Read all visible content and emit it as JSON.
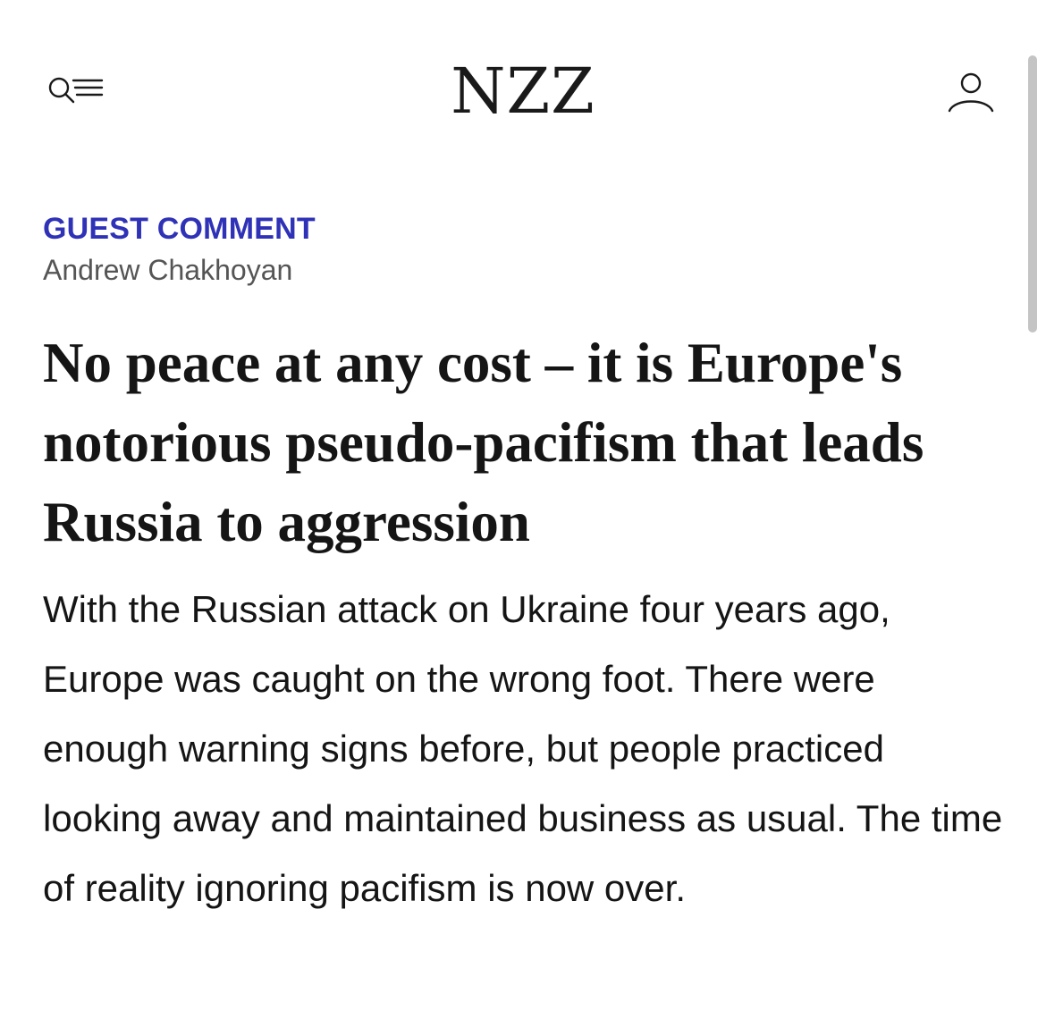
{
  "header": {
    "logo_text": "NZZ",
    "menu_icon": "search-menu-icon",
    "account_icon": "user-icon"
  },
  "article": {
    "section_label": "GUEST COMMENT",
    "author": "Andrew Chakhoyan",
    "headline": "No peace at any cost – it is Europe's notorious pseudo-pacifism that leads Russia to aggression",
    "lead": "With the Russian attack on Ukraine four years ago, Europe was caught on the wrong foot. There were enough warning signs before, but people practiced looking away and maintained business as usual. The time of reality ignoring pacifism is now over."
  },
  "colors": {
    "section_label": "#2f32b7",
    "text": "#151515",
    "author": "#555555"
  }
}
